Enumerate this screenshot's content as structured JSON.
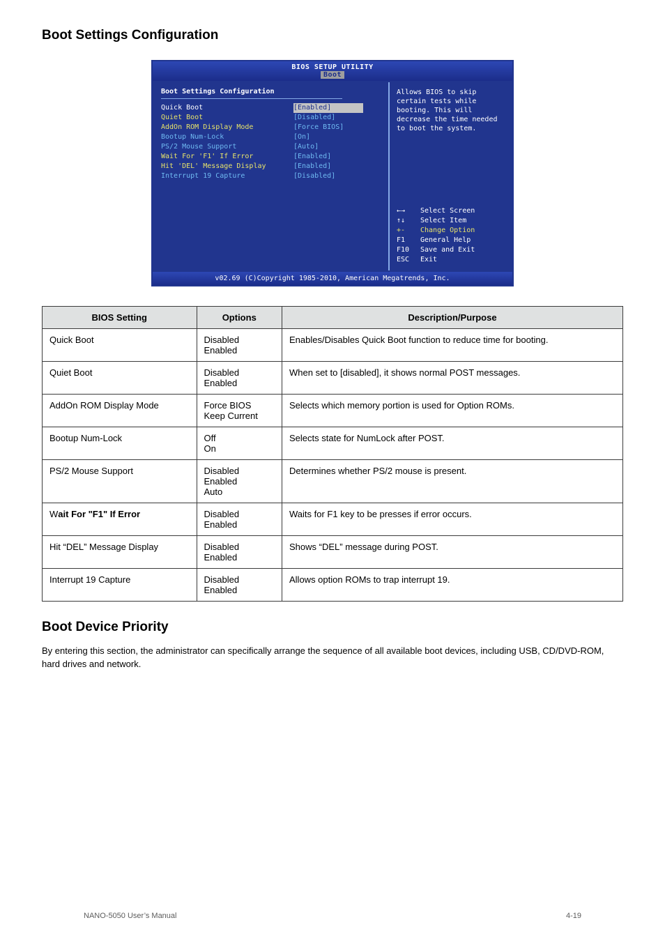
{
  "page_heading": "Boot Settings Configuration",
  "bios": {
    "window_title": "BIOS SETUP UTILITY",
    "tab": "Boot",
    "section_title": "Boot Settings Configuration",
    "rows": [
      {
        "label": "Quick Boot",
        "value": "[Enabled]",
        "highlight": true
      },
      {
        "label": "Quiet Boot",
        "value": "[Disabled]"
      },
      {
        "label": "AddOn ROM Display Mode",
        "value": "[Force BIOS]"
      },
      {
        "label": "Bootup Num-Lock",
        "value": "[On]"
      },
      {
        "label": "PS/2 Mouse Support",
        "value": "[Auto]"
      },
      {
        "label": "Wait For 'F1' If Error",
        "value": "[Enabled]"
      },
      {
        "label": "Hit 'DEL' Message Display",
        "value": "[Enabled]"
      },
      {
        "label": "Interrupt 19 Capture",
        "value": "[Disabled]"
      }
    ],
    "help_text": "Allows BIOS to skip certain tests while booting. This will decrease the time needed to boot the system.",
    "key_hints": [
      {
        "key": "←→",
        "label": "Select Screen",
        "yellow": false
      },
      {
        "key": "↑↓",
        "label": "Select Item",
        "yellow": false
      },
      {
        "key": "+-",
        "label": "Change Option",
        "yellow": true
      },
      {
        "key": "F1",
        "label": "General Help",
        "yellow": false
      },
      {
        "key": "F10",
        "label": "Save and Exit",
        "yellow": false
      },
      {
        "key": "ESC",
        "label": "Exit",
        "yellow": false
      }
    ],
    "footer": "v02.69 (C)Copyright 1985-2010, American Megatrends, Inc."
  },
  "table": {
    "headers": [
      "BIOS Setting",
      "Options",
      "Description/Purpose"
    ],
    "rows": [
      {
        "setting": "Quick Boot",
        "options": "Disabled\nEnabled",
        "desc": "Enables/Disables Quick Boot function to reduce time for booting."
      },
      {
        "setting": "Quiet Boot",
        "options": "Disabled\nEnabled",
        "desc": "When set to [disabled], it shows normal POST messages."
      },
      {
        "setting": "AddOn ROM Display Mode",
        "options": "Force BIOS\nKeep Current",
        "desc": "Selects which memory portion is used for Option ROMs."
      },
      {
        "setting": "Bootup Num-Lock",
        "options": "Off\nOn",
        "desc": "Selects state for NumLock after POST."
      },
      {
        "setting": "PS/2 Mouse Support",
        "options": "Disabled\nEnabled\nAuto",
        "desc": "Determines whether PS/2 mouse is present."
      },
      {
        "setting": "Wait For “F1” If Error",
        "options": "Disabled\nEnabled",
        "desc": "Waits for F1 key to be presses if error occurs."
      },
      {
        "setting": "Hit “DEL” Message Display",
        "options": "Disabled\nEnabled",
        "desc": "Shows “DEL” message during POST."
      },
      {
        "setting": "Interrupt 19 Capture",
        "options": "Disabled\nEnabled",
        "desc": "Allows option ROMs to trap interrupt 19."
      }
    ]
  },
  "boot_priority_heading": "Boot Device Priority",
  "boot_priority_text": "By entering this section, the administrator can specifically arrange the sequence of all available boot devices, including USB, CD/DVD-ROM, hard drives and network.",
  "footer_left": "NANO-5050 User’s Manual",
  "footer_right": "4-19"
}
